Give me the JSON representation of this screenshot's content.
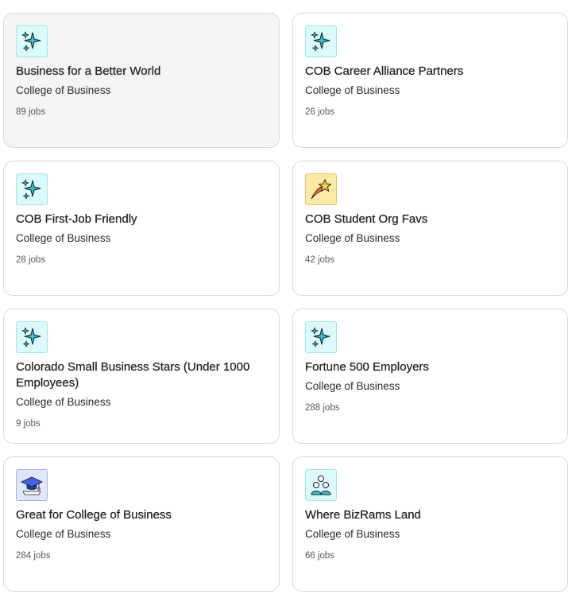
{
  "cards": [
    {
      "title": "Business for a Better World",
      "subtitle": "College of Business",
      "count": "89 jobs",
      "icon": "sparkles-icon"
    },
    {
      "title": "COB Career Alliance Partners",
      "subtitle": "College of Business",
      "count": "26 jobs",
      "icon": "sparkles-icon"
    },
    {
      "title": "COB First-Job Friendly",
      "subtitle": "College of Business",
      "count": "28 jobs",
      "icon": "sparkles-icon"
    },
    {
      "title": "COB Student Org Favs",
      "subtitle": "College of Business",
      "count": "42 jobs",
      "icon": "shooting-star-icon"
    },
    {
      "title": "Colorado Small Business Stars (Under 1000 Employees)",
      "subtitle": "College of Business",
      "count": "9 jobs",
      "icon": "sparkles-icon"
    },
    {
      "title": "Fortune 500 Employers",
      "subtitle": "College of Business",
      "count": "288 jobs",
      "icon": "sparkles-icon"
    },
    {
      "title": "Great for College of Business",
      "subtitle": "College of Business",
      "count": "284 jobs",
      "icon": "graduation-cap-icon"
    },
    {
      "title": "Where BizRams Land",
      "subtitle": "College of Business",
      "count": "66 jobs",
      "icon": "people-group-icon"
    }
  ]
}
